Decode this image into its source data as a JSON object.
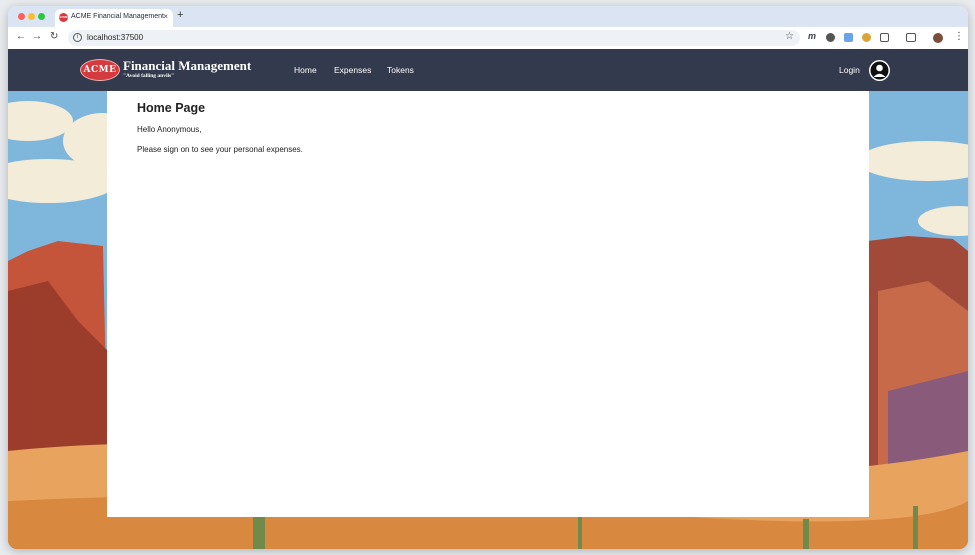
{
  "browser": {
    "tab_title": "ACME Financial Management",
    "tab_favicon_text": "ACME",
    "tab_close": "×",
    "new_tab": "+",
    "back": "←",
    "forward": "→",
    "reload": "↻",
    "info_icon": "i",
    "url": "localhost:37500",
    "bookmark": "☆",
    "menu": "⋮",
    "extensions": [
      {
        "name": "m-extension-icon",
        "symbol": "m",
        "color": "#1f1f1f"
      },
      {
        "name": "gear-extension-icon",
        "symbol": "",
        "color": "#555555"
      },
      {
        "name": "calendar-extension-icon",
        "symbol": "",
        "color": "#6aa3e8"
      },
      {
        "name": "honey-extension-icon",
        "symbol": "",
        "color": "#d8a637"
      },
      {
        "name": "puzzle-extension-icon",
        "symbol": "",
        "color": "#555555"
      }
    ]
  },
  "navbar": {
    "logo_text": "ACME",
    "brand_title": "Financial Management",
    "tagline": "\"Avoid falling anvils\"",
    "links": [
      "Home",
      "Expenses",
      "Tokens"
    ],
    "login": "Login",
    "bg_color": "#333a4d"
  },
  "main": {
    "heading": "Home Page",
    "greeting": "Hello Anonymous,",
    "message": "Please sign on to see your personal expenses."
  },
  "colors": {
    "brand_red": "#d43b3f",
    "sky": "#7fb7dc",
    "rock": "#c4553a",
    "sand": "#e8a45e"
  }
}
